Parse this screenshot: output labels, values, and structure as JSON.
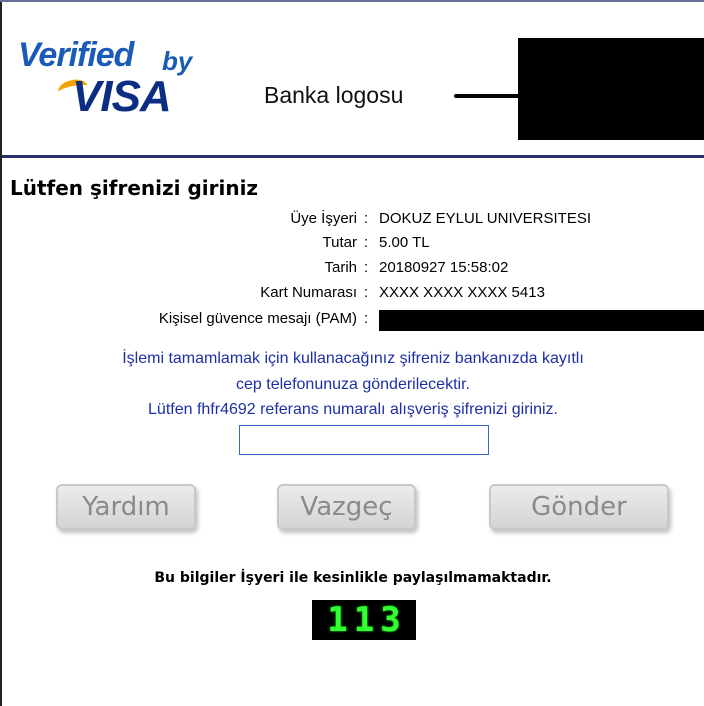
{
  "header": {
    "brand_verified": "Verified",
    "brand_by": "by",
    "brand_visa": "VISA",
    "bank_logo_label": "Banka logosu"
  },
  "form": {
    "title": "Lütfen şifrenizi giriniz",
    "fields": [
      {
        "label": "Üye İşyeri",
        "value": "DOKUZ EYLUL UNIVERSITESI"
      },
      {
        "label": "Tutar",
        "value": "5.00 TL"
      },
      {
        "label": "Tarih",
        "value": "20180927 15:58:02"
      },
      {
        "label": "Kart Numarası",
        "value": "XXXX XXXX XXXX 5413"
      },
      {
        "label": "Kişisel güvence mesajı (PAM)",
        "value": ""
      }
    ],
    "colon": ":",
    "message_line1": "İşlemi tamamlamak için kullanacağınız şifreniz bankanızda kayıtlı",
    "message_line2": "cep telefonunuza gönderilecektir.",
    "message_line3": "Lütfen fhfr4692 referans numaralı alışveriş şifrenizi giriniz.",
    "password_value": ""
  },
  "buttons": {
    "help": "Yardım",
    "cancel": "Vazgeç",
    "send": "Gönder"
  },
  "footer": {
    "privacy_note": "Bu bilgiler İşyeri ile kesinlikle paylaşılmamaktadır.",
    "counter_digits": [
      "1",
      "1",
      "3"
    ]
  },
  "colors": {
    "brand_blue": "#1a5bb8",
    "message_blue": "#1d2fa8",
    "separator": "#2a2f6e",
    "counter_green": "#33ff33"
  }
}
